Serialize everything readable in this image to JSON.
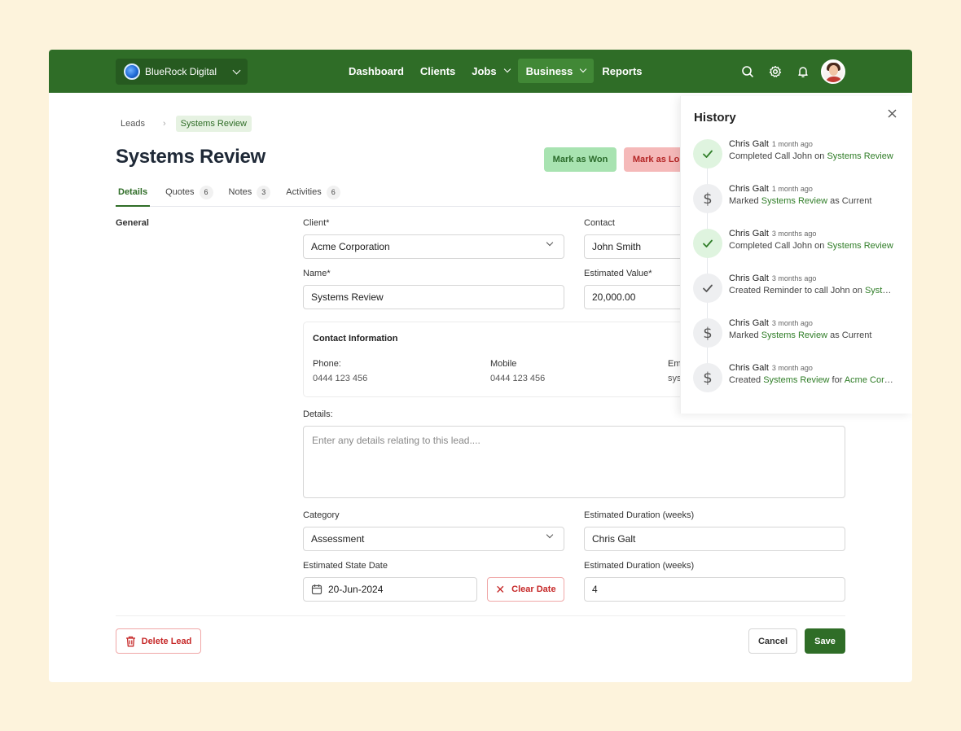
{
  "org": {
    "name": "BlueRock Digital"
  },
  "nav": {
    "items": [
      {
        "label": "Dashboard"
      },
      {
        "label": "Clients"
      },
      {
        "label": "Jobs"
      },
      {
        "label": "Business"
      },
      {
        "label": "Reports"
      }
    ],
    "active": "Business"
  },
  "breadcrumb": {
    "root": "Leads",
    "current": "Systems Review"
  },
  "page": {
    "title": "Systems Review",
    "mark_won": "Mark as Won",
    "mark_lost": "Mark as Lost"
  },
  "tabs": [
    {
      "label": "Details",
      "count": ""
    },
    {
      "label": "Quotes",
      "count": "6"
    },
    {
      "label": "Notes",
      "count": "3"
    },
    {
      "label": "Activities",
      "count": "6"
    }
  ],
  "form": {
    "section": "General",
    "client_label": "Client*",
    "client_value": "Acme Corporation",
    "contact_label": "Contact",
    "contact_value": "John Smith",
    "name_label": "Name*",
    "name_value": "Systems Review",
    "est_value_label": "Estimated Value*",
    "est_value_value": "20,000.00",
    "contact_info": {
      "title": "Contact Information",
      "phone_label": "Phone:",
      "phone_value": "0444 123 456",
      "mobile_label": "Mobile",
      "mobile_value": "0444 123 456",
      "email_label": "Em",
      "email_value": "sys"
    },
    "details_label": "Details:",
    "details_placeholder": "Enter any details relating to this lead....",
    "category_label": "Category",
    "category_value": "Assessment",
    "duration_label_1": "Estimated Duration (weeks)",
    "duration_value_1": "Chris Galt",
    "start_date_label": "Estimated State Date",
    "start_date_value": "20-Jun-2024",
    "clear_date": "Clear Date",
    "duration_label_2": "Estimated Duration (weeks)",
    "duration_value_2": "4"
  },
  "actions": {
    "delete": "Delete Lead",
    "cancel": "Cancel",
    "save": "Save"
  },
  "history": {
    "title": "History",
    "items": [
      {
        "icon": "check-icon",
        "tone": "green",
        "who": "Chris Galt",
        "when": "1 month ago",
        "pre": "Completed Call John on ",
        "link": "Systems Review",
        "mid": "",
        "link2": "",
        "post": ""
      },
      {
        "icon": "dollar-icon",
        "tone": "gray",
        "who": "Chris Galt",
        "when": "1 month ago",
        "pre": "Marked ",
        "link": "Systems Review",
        "mid": " as Current",
        "link2": "",
        "post": ""
      },
      {
        "icon": "check-icon",
        "tone": "green",
        "who": "Chris Galt",
        "when": "3 months ago",
        "pre": "Completed Call John on ",
        "link": "Systems Review",
        "mid": "",
        "link2": "",
        "post": ""
      },
      {
        "icon": "check-icon",
        "tone": "gray",
        "who": "Chris Galt",
        "when": "3 months ago",
        "pre": "Created Reminder to call John on ",
        "link": "Systems...",
        "mid": "",
        "link2": "",
        "post": ""
      },
      {
        "icon": "dollar-icon",
        "tone": "gray",
        "who": "Chris Galt",
        "when": "3 month ago",
        "pre": "Marked ",
        "link": "Systems Review",
        "mid": " as Current",
        "link2": "",
        "post": ""
      },
      {
        "icon": "dollar-icon",
        "tone": "gray",
        "who": "Chris Galt",
        "when": "3 month ago",
        "pre": "Created ",
        "link": "Systems Review",
        "mid": " for ",
        "link2": "Acme Corp...",
        "post": ""
      }
    ]
  },
  "colors": {
    "brand": "#2f6d27",
    "won": "#a8e3b1",
    "lost": "#f5b9b9",
    "danger": "#c62828"
  }
}
